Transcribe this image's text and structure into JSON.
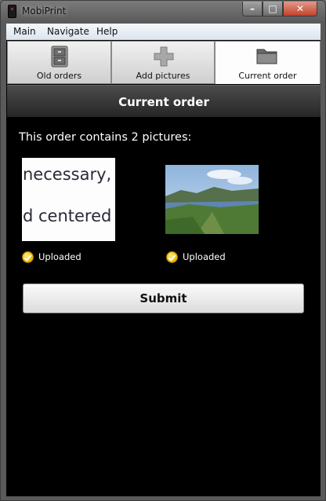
{
  "window": {
    "title": "MobiPrint",
    "controls": {
      "minimize": "–",
      "maximize": "□",
      "close": "✕"
    }
  },
  "menu": {
    "items": [
      "Main",
      "Navigate",
      "Help"
    ]
  },
  "tabs": [
    {
      "label": "Old orders",
      "icon": "cabinet-icon",
      "active": false
    },
    {
      "label": "Add pictures",
      "icon": "plus-icon",
      "active": false
    },
    {
      "label": "Current order",
      "icon": "folder-icon",
      "active": true
    }
  ],
  "page": {
    "title": "Current order",
    "summary": "This order contains 2 pictures:"
  },
  "pictures": [
    {
      "thumb_text_line1": "necessary,",
      "thumb_text_line2": "d centered",
      "status": "Uploaded"
    },
    {
      "thumb_kind": "landscape-photo",
      "status": "Uploaded"
    }
  ],
  "actions": {
    "submit_label": "Submit"
  },
  "colors": {
    "accent_header": "#2e2e2e",
    "status_badge": "#f2c100",
    "close_button": "#c3412b"
  }
}
